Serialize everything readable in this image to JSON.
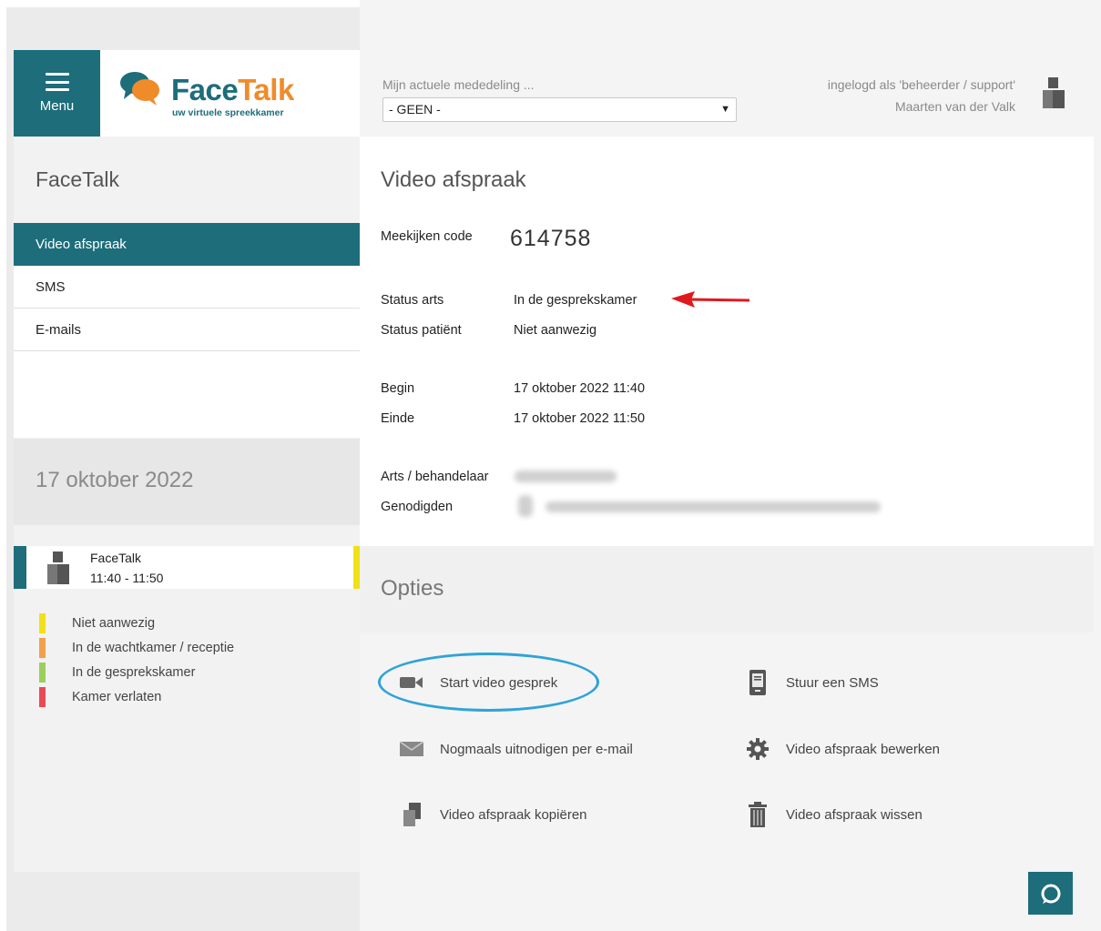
{
  "header": {
    "menu_label": "Menu",
    "logo": {
      "face": "Face",
      "talk": "Talk",
      "tagline": "uw virtuele spreekkamer"
    },
    "announcement_label": "Mijn actuele mededeling ...",
    "announcement_value": "- GEEN -",
    "login_line": "ingelogd als 'beheerder / support'",
    "user_name": "Maarten van der Valk"
  },
  "sidebar": {
    "title": "FaceTalk",
    "items": [
      {
        "label": "Video afspraak",
        "active": true
      },
      {
        "label": "SMS",
        "active": false
      },
      {
        "label": "E-mails",
        "active": false
      }
    ],
    "date": "17 oktober 2022",
    "appointment": {
      "title": "FaceTalk",
      "time": "11:40 - 11:50"
    },
    "legend": [
      {
        "label": "Niet aanwezig",
        "color": "#f0e018"
      },
      {
        "label": "In de wachtkamer / receptie",
        "color": "#f4a04a"
      },
      {
        "label": "In de gesprekskamer",
        "color": "#9ccf5a"
      },
      {
        "label": "Kamer verlaten",
        "color": "#e94a55"
      }
    ]
  },
  "main": {
    "title": "Video afspraak",
    "code_label": "Meekijken code",
    "code_value": "614758",
    "status_doctor_label": "Status arts",
    "status_doctor_value": "In de gesprekskamer",
    "status_patient_label": "Status patiënt",
    "status_patient_value": "Niet aanwezig",
    "begin_label": "Begin",
    "begin_value": "17 oktober 2022 11:40",
    "end_label": "Einde",
    "end_value": "17 oktober 2022 11:50",
    "doctor_label": "Arts / behandelaar",
    "guests_label": "Genodigden"
  },
  "options": {
    "title": "Opties",
    "start_video": "Start video gesprek",
    "send_sms": "Stuur een SMS",
    "reinvite": "Nogmaals uitnodigen per e-mail",
    "edit": "Video afspraak bewerken",
    "copy": "Video afspraak kopiëren",
    "delete": "Video afspraak wissen"
  },
  "colors": {
    "accent": "#1d6d7b",
    "brand_orange": "#f08b2a",
    "highlight": "#2fa3d8",
    "arrow": "#e0191f"
  }
}
